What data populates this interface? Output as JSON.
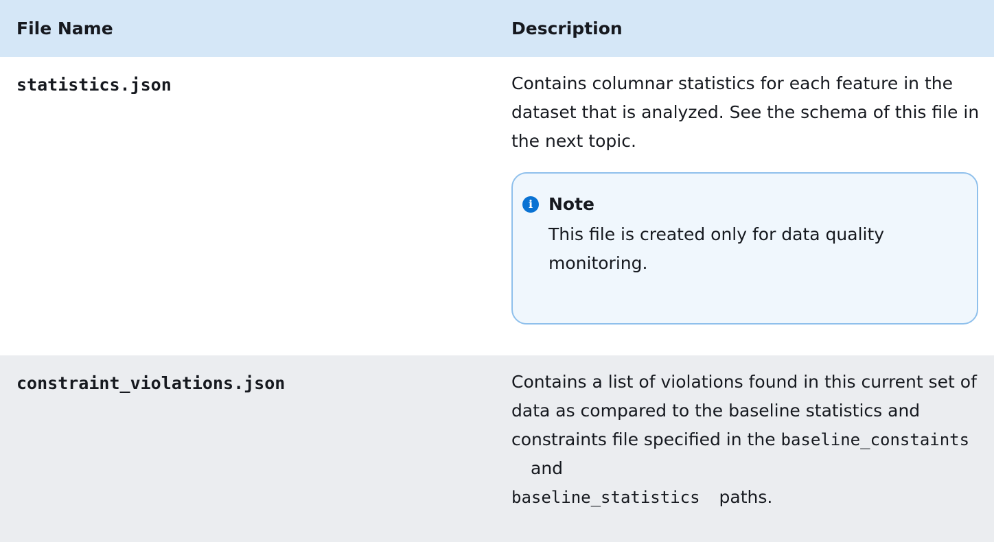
{
  "table": {
    "headers": {
      "file_name": "File Name",
      "description": "Description"
    },
    "rows": [
      {
        "file_name": "statistics.json",
        "description": "Contains columnar statistics for each feature in the dataset that is analyzed. See the schema of this file in the next topic.",
        "note": {
          "icon": "info-icon",
          "title": "Note",
          "body": "This file is created only for data quality monitoring."
        }
      },
      {
        "file_name": "constraint_violations.json",
        "description_parts": {
          "text_before": "Contains a list of violations found in this current set of data as compared to the baseline statistics and constraints file specified in the",
          "code_1": "baseline_constaints",
          "text_middle": "and",
          "code_2": "baseline_statistics",
          "text_after": "paths."
        }
      }
    ]
  },
  "colors": {
    "header_bg": "#d5e7f7",
    "alt_row_bg": "#ebedf0",
    "note_border": "#8fc0ec",
    "note_bg": "#f0f7fd",
    "info_icon": "#0972d3",
    "text": "#16191f"
  }
}
